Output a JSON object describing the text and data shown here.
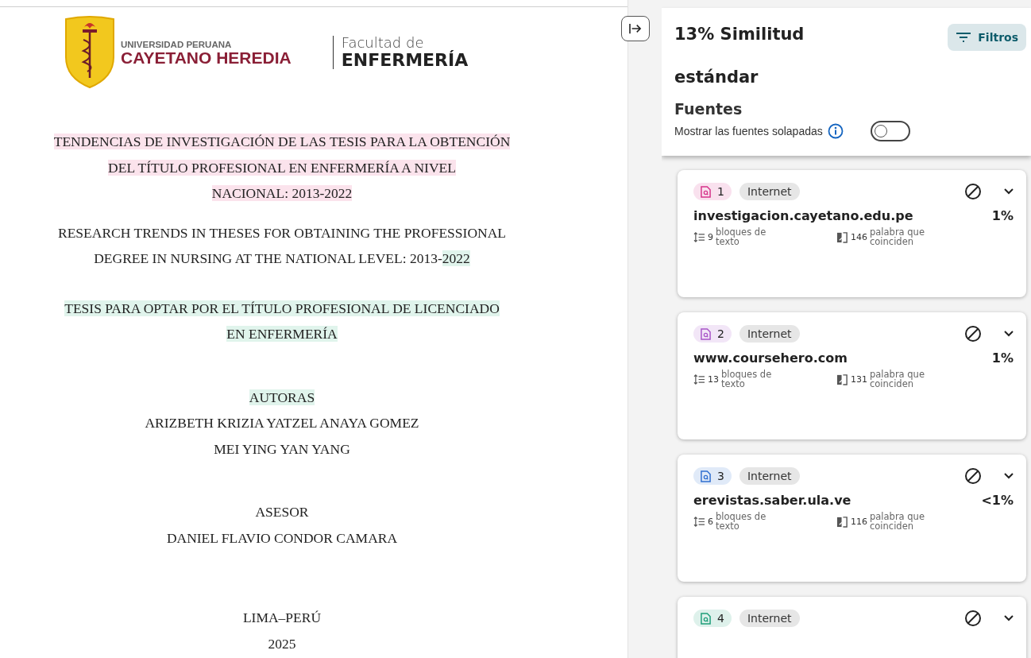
{
  "document": {
    "logo": {
      "university_line1": "UNIVERSIDAD PERUANA",
      "university_line2": "CAYETANO HEREDIA",
      "faculty_line1": "Facultad de",
      "faculty_line2": "ENFERMERÍA"
    },
    "paragraphs": [
      {
        "lines": [
          [
            {
              "text": "TENDENCIAS DE INVESTIGACIÓN DE LAS TESIS PARA LA OBTENCIÓN",
              "color": "#fbe3ec"
            }
          ],
          [
            {
              "text": "DEL TÍTULO PROFESIONAL EN ENFERMERÍA A NIVEL",
              "color": "#fbe3ec"
            }
          ],
          [
            {
              "text": "NACIONAL: 2013-2022",
              "color": "#fbe3ec"
            }
          ]
        ]
      },
      {
        "lines": [
          [
            {
              "text": "RESEARCH TRENDS IN THESES FOR OBTAINING THE PROFESSIONAL"
            }
          ],
          [
            {
              "text": "DEGREE IN NURSING AT THE NATIONAL LEVEL: 2013-"
            },
            {
              "text": "2022",
              "color": "#e0f4ec"
            }
          ]
        ]
      },
      {
        "lines": [
          [
            {
              "text": "TESIS PARA OPTAR POR EL TÍTULO PROFESIONAL DE LICENCIADO",
              "color": "#e0f4ec"
            }
          ],
          [
            {
              "text": "EN ENFERMERÍA",
              "color": "#e0f4ec"
            }
          ]
        ]
      },
      {
        "lines": [
          [
            {
              "text": "AUTORAS",
              "color": "#e0f4ec"
            }
          ],
          [
            {
              "text": "ARIZBETH KRIZIA YATZEL ANAYA GOMEZ"
            }
          ],
          [
            {
              "text": "MEI YING YAN YANG"
            }
          ]
        ]
      },
      {
        "lines": [
          [
            {
              "text": "ASESOR"
            }
          ],
          [
            {
              "text": "DANIEL FLAVIO CONDOR CAMARA"
            }
          ]
        ]
      },
      {
        "lines": [
          [
            {
              "text": "LIMA–PERÚ"
            }
          ],
          [
            {
              "text": "2025"
            }
          ]
        ]
      }
    ]
  },
  "panel": {
    "title": "13% Similitud estándar",
    "filter_button": "Filtros",
    "section_title": "Fuentes",
    "overlap_label": "Mostrar las fuentes solapadas",
    "overlap_toggle": {
      "on": false
    },
    "sources": [
      {
        "number": "1",
        "color": "#d6338a",
        "type": "Internet",
        "domain": "investigacion.cayetano.edu.pe",
        "percent": "1%",
        "blocks": "9",
        "blocks_label": "bloques de texto",
        "words": "146",
        "words_label": "palabra que coinciden"
      },
      {
        "number": "2",
        "color": "#a855c8",
        "type": "Internet",
        "domain": "www.coursehero.com",
        "percent": "1%",
        "blocks": "13",
        "blocks_label": "bloques de texto",
        "words": "131",
        "words_label": "palabra que coinciden"
      },
      {
        "number": "3",
        "color": "#2f6fd0",
        "type": "Internet",
        "domain": "erevistas.saber.ula.ve",
        "percent": "<1%",
        "blocks": "6",
        "blocks_label": "bloques de texto",
        "words": "116",
        "words_label": "palabra que coinciden"
      },
      {
        "number": "4",
        "color": "#1f9e7a",
        "type": "Internet"
      }
    ]
  }
}
